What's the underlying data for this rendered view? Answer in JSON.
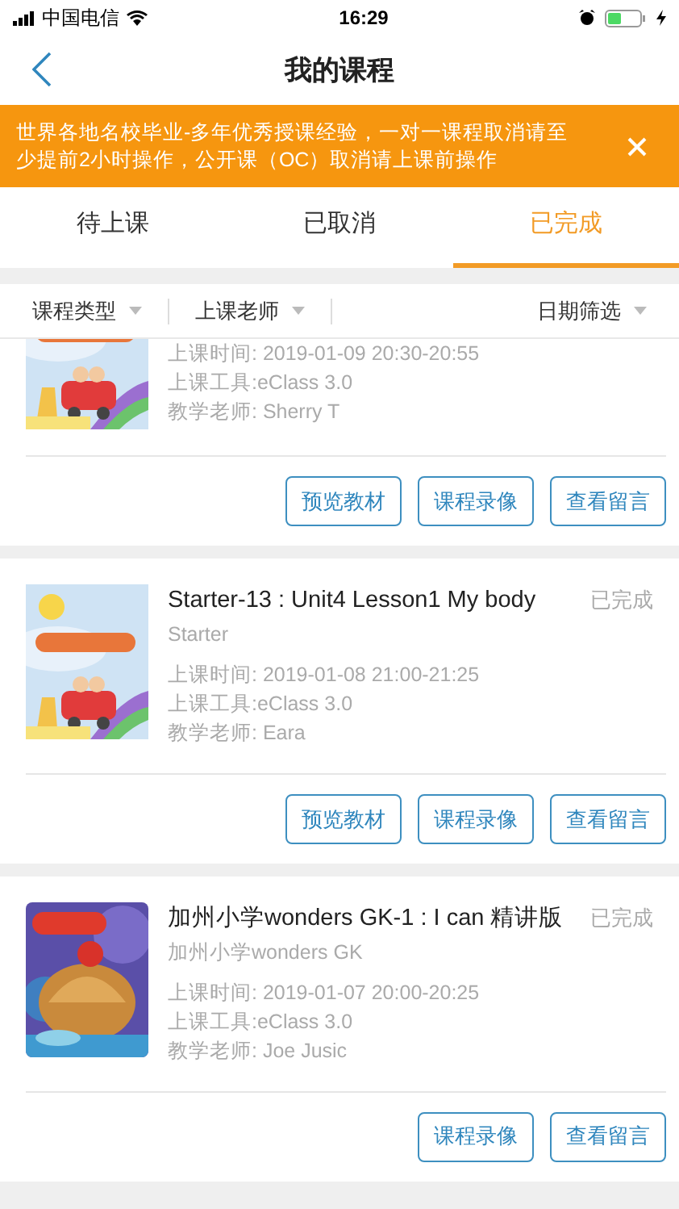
{
  "status_bar": {
    "carrier": "中国电信",
    "time": "16:29"
  },
  "nav": {
    "title": "我的课程"
  },
  "banner": {
    "text": "世界各地名校毕业-多年优秀授课经验，一对一课程取消请至少提前2小时操作，公开课（OC）取消请上课前操作"
  },
  "tabs": [
    {
      "label": "待上课",
      "selected": false
    },
    {
      "label": "已取消",
      "selected": false
    },
    {
      "label": "已完成",
      "selected": true
    }
  ],
  "filters": [
    {
      "label": "课程类型"
    },
    {
      "label": "上课老师"
    },
    {
      "label": "日期筛选"
    }
  ],
  "courses": [
    {
      "cover": {
        "kind": "picture"
      },
      "time": "上课时间: 2019-01-09 20:30-20:55",
      "tool": "上课工具:eClass 3.0",
      "teacher": "教学老师: Sherry T",
      "buttons": [
        "预览教材",
        "课程录像",
        "查看留言"
      ]
    },
    {
      "cover": {
        "kind": "picture"
      },
      "title": "Starter-13 : Unit4 Lesson1 My body",
      "status": "已完成",
      "subtitle": "Starter",
      "time": "上课时间: 2019-01-08 21:00-21:25",
      "tool": "上课工具:eClass 3.0",
      "teacher": "教学老师: Eara",
      "buttons": [
        "预览教材",
        "课程录像",
        "查看留言"
      ]
    },
    {
      "cover": {
        "kind": "picture"
      },
      "title": "加州小学wonders GK-1 : I can 精讲版",
      "status": "已完成",
      "subtitle": "加州小学wonders GK",
      "time": "上课时间: 2019-01-07 20:00-20:25",
      "tool": "上课工具:eClass 3.0",
      "teacher": "教学老师: Joe Jusic",
      "buttons": [
        "课程录像",
        "查看留言"
      ]
    }
  ]
}
